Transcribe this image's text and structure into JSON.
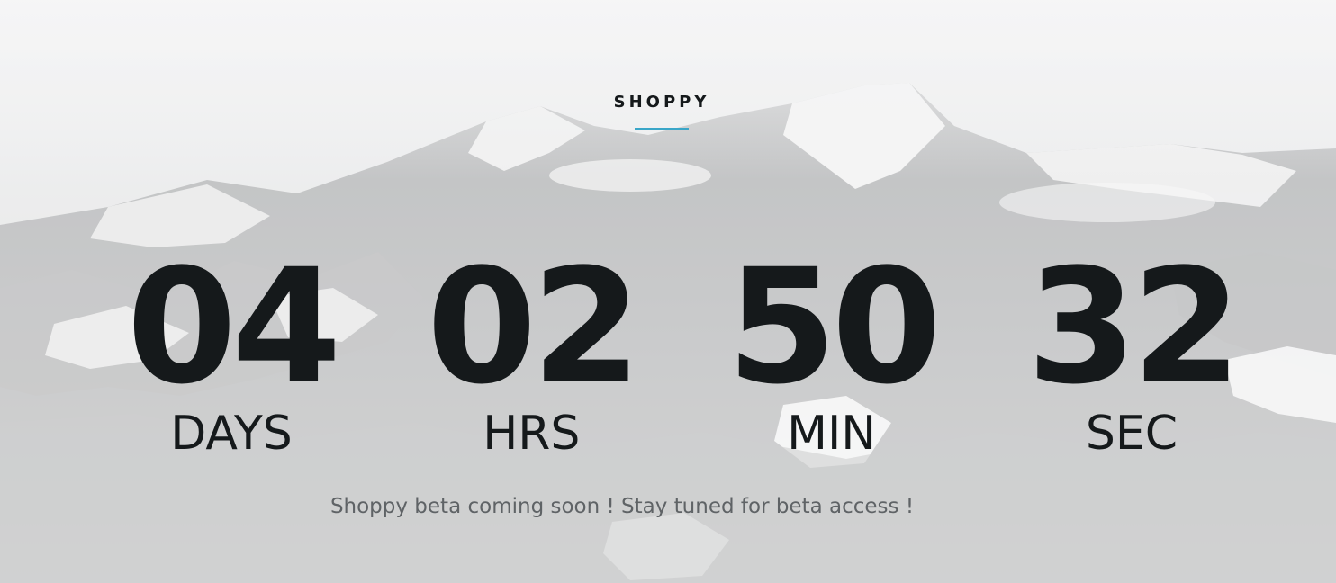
{
  "brand": {
    "name": "SHOPPY",
    "accent_color": "#3aa6c8"
  },
  "countdown": {
    "units": [
      {
        "value": "04",
        "label": "DAYS"
      },
      {
        "value": "02",
        "label": "HRS"
      },
      {
        "value": "50",
        "label": "MIN"
      },
      {
        "value": "32",
        "label": "SEC"
      }
    ]
  },
  "tagline": "Shoppy beta coming soon ! Stay tuned for beta access !",
  "background": {
    "image": "snowy-mountain-photo",
    "tint": "#e6e7e8"
  }
}
